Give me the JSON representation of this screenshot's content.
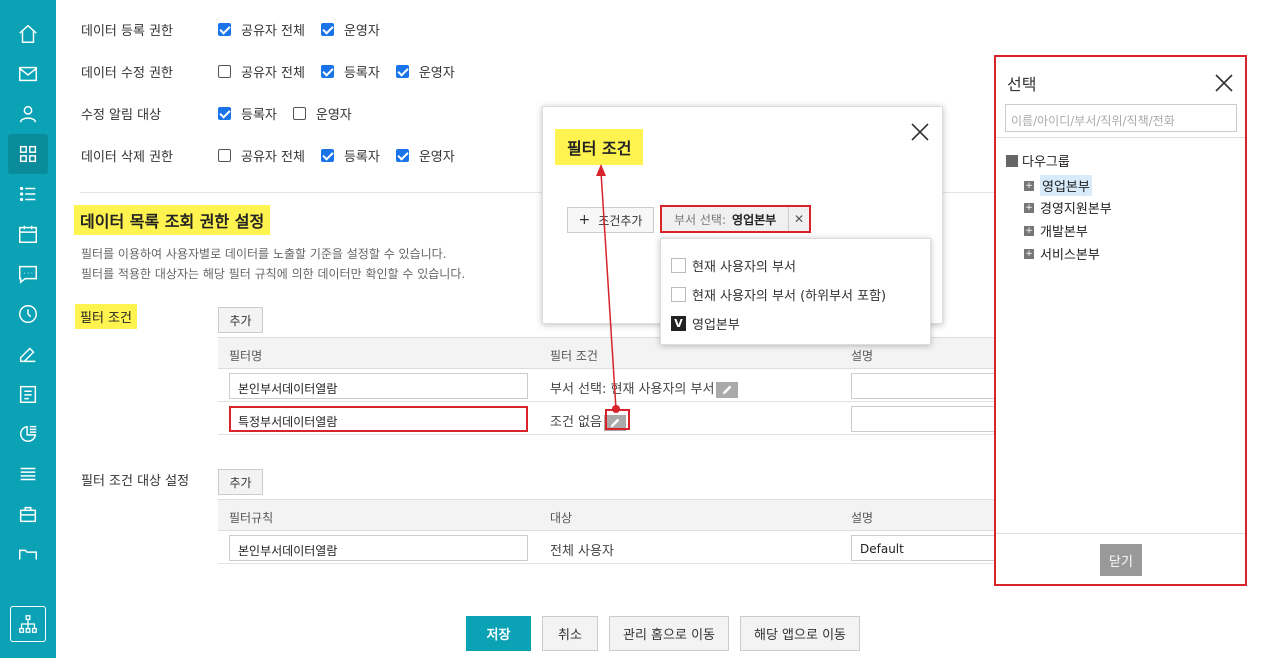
{
  "permissions": [
    {
      "label": "데이터 등록 권한",
      "options": [
        {
          "text": "공유자 전체",
          "checked": true
        },
        {
          "text": "운영자",
          "checked": true
        }
      ]
    },
    {
      "label": "데이터 수정 권한",
      "options": [
        {
          "text": "공유자 전체",
          "checked": false
        },
        {
          "text": "등록자",
          "checked": true
        },
        {
          "text": "운영자",
          "checked": true
        }
      ]
    },
    {
      "label": "수정 알림 대상",
      "options": [
        {
          "text": "등록자",
          "checked": true
        },
        {
          "text": "운영자",
          "checked": false
        }
      ]
    },
    {
      "label": "데이터 삭제 권한",
      "options": [
        {
          "text": "공유자 전체",
          "checked": false
        },
        {
          "text": "등록자",
          "checked": true
        },
        {
          "text": "운영자",
          "checked": true
        }
      ]
    }
  ],
  "section": {
    "title": "데이터 목록 조회 권한 설정",
    "desc1": "필터를 이용하여 사용자별로 데이터를 노출할 기준을 설정할 수 있습니다.",
    "desc2": "필터를 적용한 대상자는 해당 필터 규칙에 의한 데이터만 확인할 수 있습니다."
  },
  "filter_table": {
    "label": "필터 조건",
    "add": "추가",
    "headers": [
      "필터명",
      "필터 조건",
      "설명"
    ],
    "rows": [
      {
        "name": "본인부서데이터열람",
        "cond": "부서 선택: 현재 사용자의 부서"
      },
      {
        "name": "특정부서데이터열람",
        "cond": "조건 없음"
      }
    ]
  },
  "target_table": {
    "label": "필터 조건 대상 설정",
    "add": "추가",
    "headers": [
      "필터규칙",
      "대상",
      "설명"
    ],
    "rows": [
      {
        "rule": "본인부서데이터열람",
        "target": "전체 사용자",
        "desc": "Default"
      }
    ]
  },
  "buttons": {
    "save": "저장",
    "cancel": "취소",
    "home": "관리 홈으로 이동",
    "app": "해당 앱으로 이동"
  },
  "popup": {
    "title": "필터 조건",
    "add_cond": "조건추가",
    "tag_key": "부서 선택:",
    "tag_value": "영업본부",
    "dropdown": [
      {
        "text": "현재 사용자의 부서",
        "checked": false
      },
      {
        "text": "현재 사용자의 부서 (하위부서 포함)",
        "checked": false
      },
      {
        "text": "영업본부",
        "checked": true
      }
    ]
  },
  "selector": {
    "title": "선택",
    "placeholder": "이름/아이디/부서/직위/직책/전화",
    "root": "다우그룹",
    "items": [
      "영업본부",
      "경영지원본부",
      "개발본부",
      "서비스본부"
    ],
    "close": "닫기"
  },
  "rail_icons": [
    "home-icon",
    "mail-icon",
    "user-icon",
    "apps-icon",
    "list-icon",
    "calendar-icon",
    "chat-icon",
    "clock-icon",
    "edit-icon",
    "report-icon",
    "chart-icon",
    "stack-icon",
    "briefcase-icon",
    "folder-icon",
    "org-chart-icon"
  ],
  "colors": {
    "accent": "#0ba2b5",
    "highlight": "#fff34f",
    "annotation": "#d8232a"
  }
}
